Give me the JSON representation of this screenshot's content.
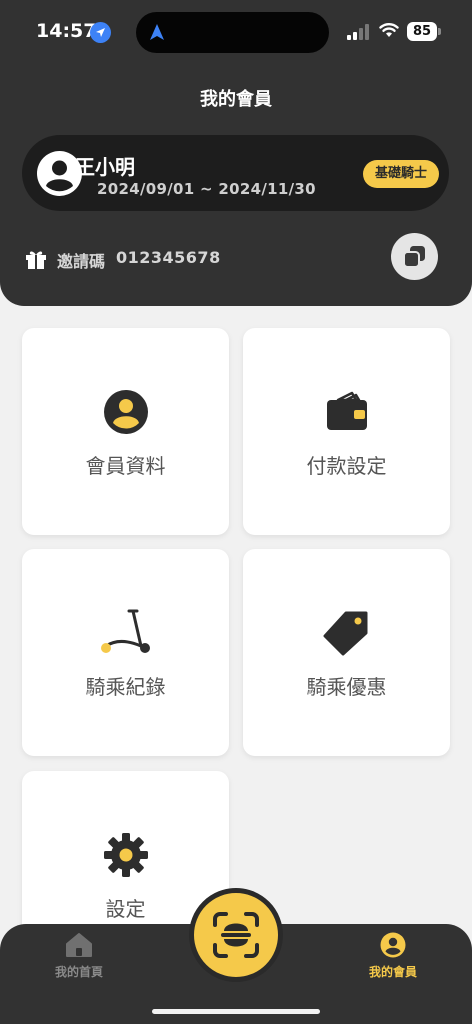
{
  "status_bar": {
    "time": "14:57",
    "battery": "85"
  },
  "header": {
    "title": "我的會員"
  },
  "member": {
    "name": "王小明",
    "period": "2024/09/01 ~ 2024/11/30",
    "tier": "基礎騎士"
  },
  "invite": {
    "label": "邀請碼",
    "code": "012345678"
  },
  "tiles": {
    "profile": "會員資料",
    "payment": "付款設定",
    "ride_history": "騎乘紀錄",
    "ride_offers": "騎乘優惠",
    "settings": "設定"
  },
  "bottom_nav": {
    "home": "我的首頁",
    "member": "我的會員"
  },
  "colors": {
    "accent": "#f5c94a",
    "header_bg": "#323232",
    "page_bg": "#f1f1f1"
  }
}
